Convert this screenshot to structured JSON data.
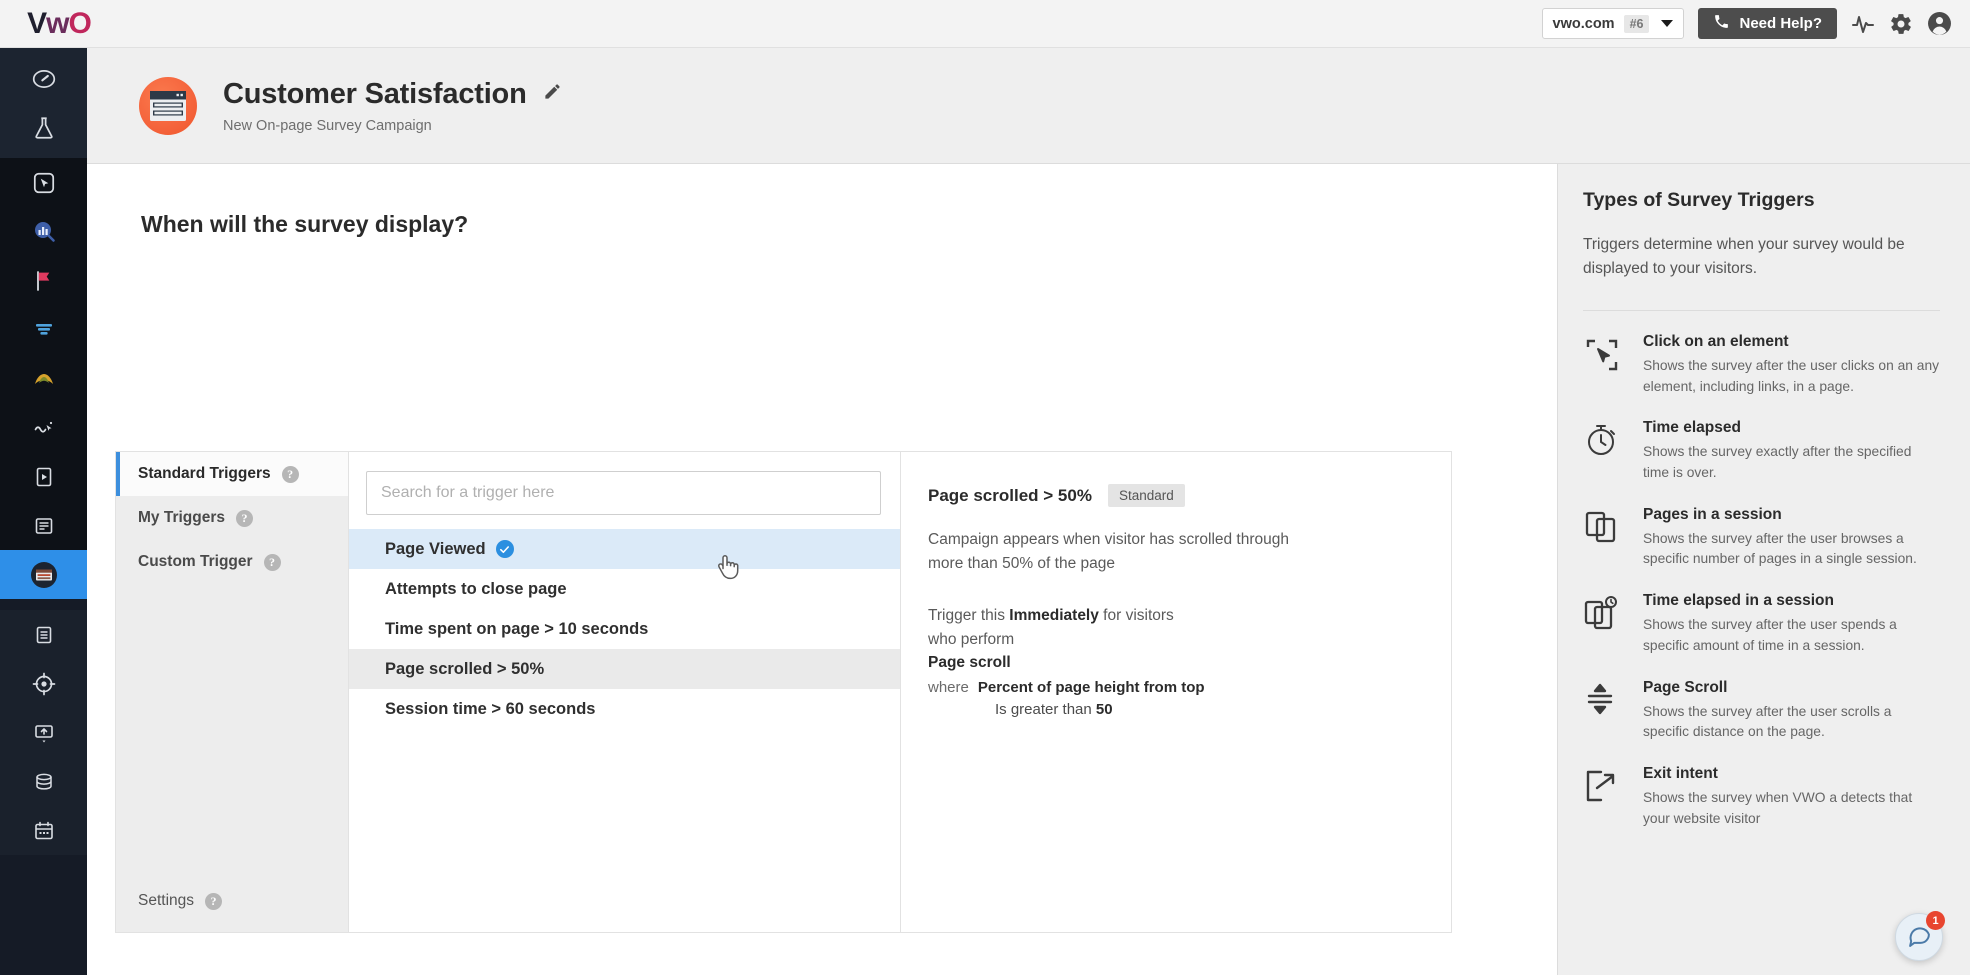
{
  "topbar": {
    "logo": "VWO",
    "domain": {
      "name": "vwo.com",
      "badge": "#6"
    },
    "help_button": "Need Help?",
    "icons": [
      "activity-icon",
      "gear-icon",
      "user-avatar-icon"
    ]
  },
  "sidebar": {
    "items": [
      {
        "name": "dashboard",
        "icon": "speedometer-icon"
      },
      {
        "name": "testing",
        "icon": "flask-icon"
      },
      {
        "name": "click-map",
        "icon": "cursor-box-icon"
      },
      {
        "name": "analytics",
        "icon": "bar-chart-search-icon"
      },
      {
        "name": "goals",
        "icon": "flag-icon"
      },
      {
        "name": "funnels",
        "icon": "funnel-icon"
      },
      {
        "name": "heatmaps",
        "icon": "heatmap-icon"
      },
      {
        "name": "session-recordings",
        "icon": "recording-icon"
      },
      {
        "name": "form-analytics",
        "icon": "form-play-icon"
      },
      {
        "name": "pages",
        "icon": "page-list-icon"
      },
      {
        "name": "surveys",
        "icon": "survey-icon",
        "active": true
      },
      {
        "name": "reports",
        "icon": "clipboard-icon"
      },
      {
        "name": "targeting",
        "icon": "crosshair-icon"
      },
      {
        "name": "deploy",
        "icon": "deploy-icon"
      },
      {
        "name": "data-layer",
        "icon": "database-icon"
      },
      {
        "name": "schedule",
        "icon": "calendar-icon"
      }
    ]
  },
  "campaign": {
    "title": "Customer Satisfaction",
    "subtitle": "New On-page Survey Campaign",
    "edit_icon": "pencil-icon",
    "avatar_icon": "survey-card-icon"
  },
  "main": {
    "section_title": "When will the survey display?",
    "tabs": [
      {
        "label": "Standard Triggers",
        "active": true,
        "help": "?"
      },
      {
        "label": "My Triggers",
        "active": false,
        "help": "?"
      },
      {
        "label": "Custom Trigger",
        "active": false,
        "help": "?"
      }
    ],
    "settings": {
      "label": "Settings",
      "help": "?"
    },
    "search": {
      "placeholder": "Search for a trigger here",
      "value": ""
    },
    "triggers": [
      {
        "label": "Page Viewed",
        "selected": true,
        "checked": true
      },
      {
        "label": "Attempts to close page",
        "selected": false,
        "checked": false
      },
      {
        "label": "Time spent on page > 10 seconds",
        "selected": false,
        "checked": false
      },
      {
        "label": "Page scrolled > 50%",
        "selected": false,
        "checked": false,
        "hovered": true
      },
      {
        "label": "Session time > 60 seconds",
        "selected": false,
        "checked": false
      }
    ],
    "detail": {
      "title": "Page scrolled > 50%",
      "badge": "Standard",
      "description": "Campaign appears when visitor has scrolled through more than 50% of the page",
      "trigger_prefix": "Trigger this ",
      "trigger_strong": "Immediately",
      "trigger_suffix": " for visitors",
      "perform_line": "who perform",
      "event_name": "Page scroll",
      "where_keyword": "where",
      "where_attribute": "Percent of page height from top",
      "where_condition_prefix": "Is greater than ",
      "where_condition_value": "50"
    }
  },
  "help": {
    "title": "Types of Survey Triggers",
    "intro": "Triggers determine when your survey would be displayed to your visitors.",
    "items": [
      {
        "title": "Click on an element",
        "desc": "Shows the survey after the user clicks on an any element, including links, in a page.",
        "icon": "click-element-icon"
      },
      {
        "title": "Time elapsed",
        "desc": "Shows the survey exactly after the specified time is over.",
        "icon": "stopwatch-icon"
      },
      {
        "title": "Pages in a session",
        "desc": "Shows the survey after the user browses a specific number of pages in a single session.",
        "icon": "pages-stack-icon"
      },
      {
        "title": "Time elapsed in a session",
        "desc": "Shows the survey after the user spends a specific amount of time in a session.",
        "icon": "pages-clock-icon"
      },
      {
        "title": "Page Scroll",
        "desc": "Shows the survey after the user scrolls a specific distance on the page.",
        "icon": "scroll-arrows-icon"
      },
      {
        "title": "Exit intent",
        "desc": "Shows the survey when VWO a detects that your website visitor",
        "icon": "exit-intent-icon"
      }
    ]
  },
  "chat": {
    "badge": "1",
    "icon": "chat-bubble-icon"
  },
  "colors": {
    "accent_blue": "#2e8fe8",
    "sidebar_dark": "#151b26",
    "campaign_orange": "#f4623a",
    "badge_red": "#e8452f"
  }
}
